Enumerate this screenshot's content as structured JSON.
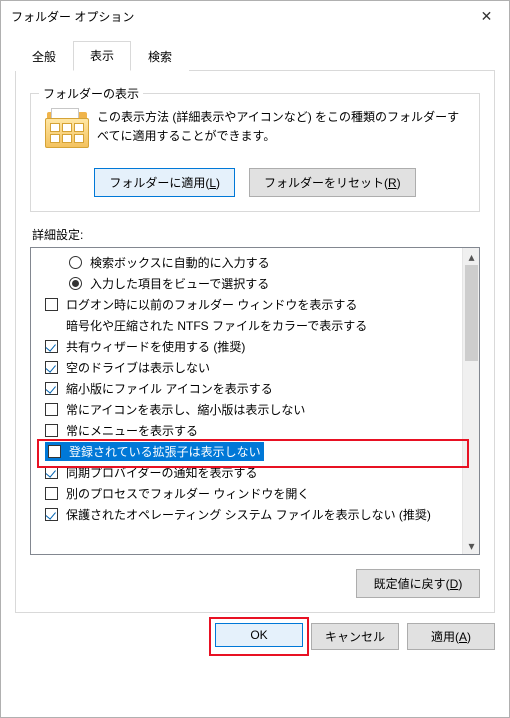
{
  "window": {
    "title": "フォルダー オプション"
  },
  "tabs": {
    "general": "全般",
    "view": "表示",
    "search": "検索"
  },
  "folder_display": {
    "group_title": "フォルダーの表示",
    "desc": "この表示方法 (詳細表示やアイコンなど) をこの種類のフォルダーすべてに適用することができます。",
    "apply_btn": "フォルダーに適用(L)",
    "reset_btn": "フォルダーをリセット(R)"
  },
  "advanced": {
    "label": "詳細設定:",
    "items": [
      {
        "kind": "radio",
        "indent": true,
        "checked": false,
        "label": "検索ボックスに自動的に入力する"
      },
      {
        "kind": "radio",
        "indent": true,
        "checked": true,
        "label": "入力した項目をビューで選択する"
      },
      {
        "kind": "check",
        "indent": false,
        "checked": false,
        "label": "ログオン時に以前のフォルダー ウィンドウを表示する"
      },
      {
        "kind": "none",
        "indent": false,
        "checked": false,
        "label": "暗号化や圧縮された NTFS ファイルをカラーで表示する"
      },
      {
        "kind": "check",
        "indent": false,
        "checked": true,
        "label": "共有ウィザードを使用する (推奨)"
      },
      {
        "kind": "check",
        "indent": false,
        "checked": true,
        "label": "空のドライブは表示しない"
      },
      {
        "kind": "check",
        "indent": false,
        "checked": true,
        "label": "縮小版にファイル アイコンを表示する"
      },
      {
        "kind": "check",
        "indent": false,
        "checked": false,
        "label": "常にアイコンを表示し、縮小版は表示しない"
      },
      {
        "kind": "check",
        "indent": false,
        "checked": false,
        "label": "常にメニューを表示する"
      },
      {
        "kind": "check",
        "indent": false,
        "checked": false,
        "label": "登録されている拡張子は表示しない",
        "selected": true
      },
      {
        "kind": "check",
        "indent": false,
        "checked": true,
        "label": "同期プロバイダーの通知を表示する"
      },
      {
        "kind": "check",
        "indent": false,
        "checked": false,
        "label": "別のプロセスでフォルダー ウィンドウを開く"
      },
      {
        "kind": "check",
        "indent": false,
        "checked": true,
        "label": "保護されたオペレーティング システム ファイルを表示しない (推奨)"
      }
    ],
    "restore_btn": "既定値に戻す(D)"
  },
  "dialog": {
    "ok": "OK",
    "cancel": "キャンセル",
    "apply": "適用(A)"
  }
}
